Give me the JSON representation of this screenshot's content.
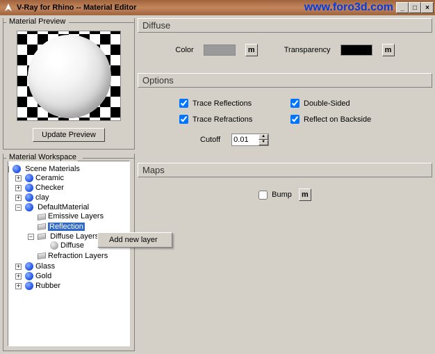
{
  "window": {
    "title": "V-Ray for Rhino -- Material Editor",
    "watermark": "www.foro3d.com"
  },
  "preview": {
    "group_label": "Material Preview",
    "update_btn": "Update Preview"
  },
  "workspace": {
    "group_label": "Material Workspace",
    "root": "Scene Materials",
    "items": [
      "Ceramic",
      "Checker",
      "clay"
    ],
    "default_mat": "DefaultMaterial",
    "layers": {
      "emissive": "Emissive Layers",
      "reflection": "Reflection",
      "diffuse_layers": "Diffuse Layers",
      "diffuse": "Diffuse",
      "refraction": "Refraction Layers"
    },
    "tail": [
      "Glass",
      "Gold",
      "Rubber"
    ],
    "context_menu": "Add new layer"
  },
  "diffuse": {
    "header": "Diffuse",
    "color_label": "Color",
    "transparency_label": "Transparency",
    "m": "m"
  },
  "options": {
    "header": "Options",
    "trace_refl": "Trace Reflections",
    "trace_refr": "Trace Refractions",
    "double_sided": "Double-Sided",
    "reflect_back": "Reflect on Backside",
    "cutoff_label": "Cutoff",
    "cutoff_value": "0.01"
  },
  "maps": {
    "header": "Maps",
    "bump_label": "Bump",
    "m": "m"
  }
}
